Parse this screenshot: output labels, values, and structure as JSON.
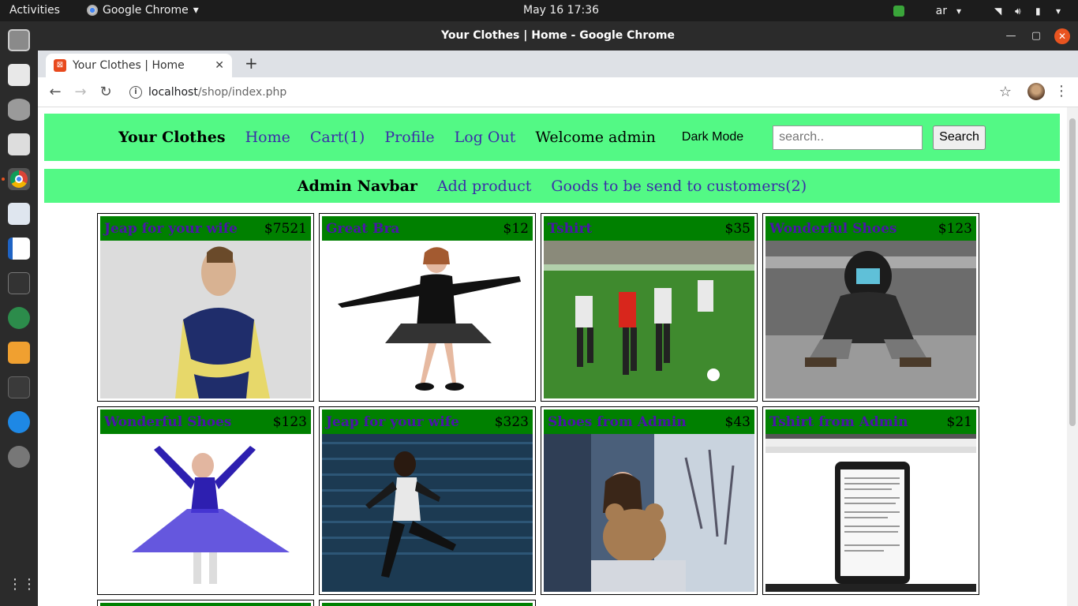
{
  "topbar": {
    "activities": "Activities",
    "app_name": "Google Chrome",
    "clock": "May 16  17:36",
    "lang": "ar"
  },
  "window": {
    "title": "Your Clothes | Home - Google Chrome"
  },
  "tab": {
    "title": "Your Clothes | Home"
  },
  "omnibox": {
    "host": "localhost",
    "path": "/shop/index.php"
  },
  "nav": {
    "brand": "Your Clothes",
    "home": "Home",
    "cart": "Cart(1)",
    "profile": "Profile",
    "logout": "Log Out",
    "welcome": "Welcome admin",
    "dark_mode": "Dark Mode",
    "search_placeholder": "search..",
    "search_button": "Search"
  },
  "admin_nav": {
    "title": "Admin Navbar",
    "add_product": "Add product",
    "goods": "Goods to be send to customers(2)"
  },
  "products": [
    {
      "name": "Jeap for your wife",
      "price": "$7521",
      "image": "boy-in-shirt"
    },
    {
      "name": "Great Bra",
      "price": "$12",
      "image": "dancer-black"
    },
    {
      "name": "Tshirt",
      "price": "$35",
      "image": "football-players"
    },
    {
      "name": "Wonderful Shoes",
      "price": "$123",
      "image": "hooded-man"
    },
    {
      "name": "Wonderful Shoes",
      "price": "$123",
      "image": "ballerina-blue"
    },
    {
      "name": "Jeap for your wife",
      "price": "$323",
      "image": "dancer-street"
    },
    {
      "name": "Shoes from Admin",
      "price": "$43",
      "image": "girl-teddy"
    },
    {
      "name": "Tshirt from Admin",
      "price": "$21",
      "image": "screenshot-doc"
    }
  ]
}
